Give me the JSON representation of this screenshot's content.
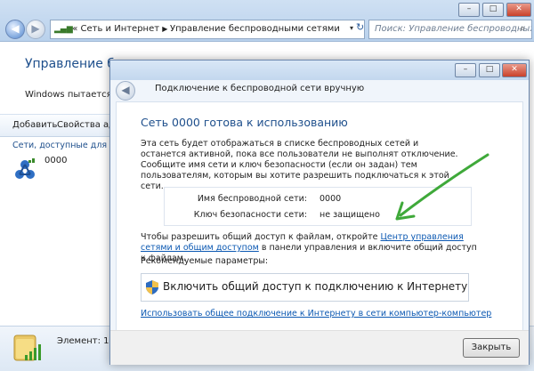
{
  "explorer": {
    "address_prefix": "«",
    "breadcrumb": [
      "Сеть и Интернет",
      "Управление беспроводными сетями"
    ],
    "search_placeholder": "Поиск: Управление беспроводных ...",
    "title": "Управление беспр",
    "description": "Windows пытается подк",
    "toolbar": {
      "add": "Добавить",
      "properties": "Свойства ада"
    },
    "available_label": "Сети, доступные для прос",
    "network_name": "0000",
    "status_text": "Элемент: 1"
  },
  "dialog": {
    "caption": "Подключение к беспроводной сети вручную",
    "heading": "Сеть 0000 готова к использованию",
    "paragraph": "Эта сеть будет отображаться в списке беспроводных сетей и останется активной, пока все пользователи не выполнят отключение. Сообщите имя сети и ключ безопасности (если он задан) тем пользователям, которым вы хотите разрешить подключаться к этой сети.",
    "ssid_label": "Имя беспроводной сети:",
    "ssid_value": "0000",
    "key_label": "Ключ безопасности сети:",
    "key_value": "не защищено",
    "share_text_before": "Чтобы разрешить общий доступ к файлам, откройте ",
    "share_link": "Центр управления сетями и общим доступом",
    "share_text_after": " в панели управления и включите общий доступ к файлам.",
    "recommended_label": "Рекомендуемые параметры:",
    "share_button": "Включить общий доступ к подключению к Интернету",
    "adhoc_link": "Использовать общее подключение к Интернету в сети компьютер-компьютер",
    "close_button": "Закрыть"
  },
  "colors": {
    "heading_blue": "#1e4f8c",
    "link_blue": "#0b58b2",
    "annotation_arrow": "#3fa93a"
  },
  "icons": [
    "back-icon",
    "forward-icon",
    "network-icon",
    "shield-icon",
    "wireless-network-icon",
    "folder-signal-icon",
    "annotation-arrow"
  ]
}
